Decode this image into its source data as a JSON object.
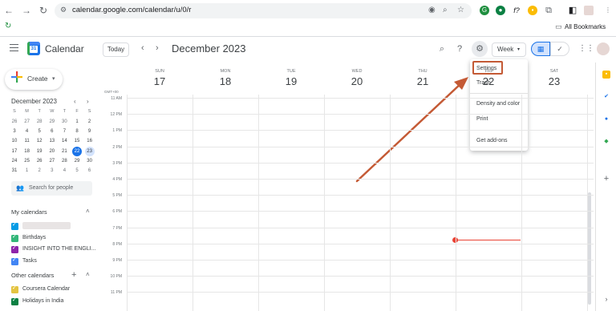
{
  "browser": {
    "url": "calendar.google.com/calendar/u/0/r",
    "bookmarks_label": "All Bookmarks"
  },
  "app": {
    "title": "Calendar",
    "today_label": "Today",
    "month_title": "December 2023",
    "view_select": "Week"
  },
  "create": {
    "label": "Create"
  },
  "mini_calendar": {
    "title": "December 2023",
    "weekday_heads": [
      "S",
      "M",
      "T",
      "W",
      "T",
      "F",
      "S"
    ],
    "weeks": [
      [
        "26",
        "27",
        "28",
        "29",
        "30",
        "1",
        "2"
      ],
      [
        "3",
        "4",
        "5",
        "6",
        "7",
        "8",
        "9"
      ],
      [
        "10",
        "11",
        "12",
        "13",
        "14",
        "15",
        "16"
      ],
      [
        "17",
        "18",
        "19",
        "20",
        "21",
        "22",
        "23"
      ],
      [
        "24",
        "25",
        "26",
        "27",
        "28",
        "29",
        "30"
      ],
      [
        "31",
        "1",
        "2",
        "3",
        "4",
        "5",
        "6"
      ]
    ],
    "selected_day": "22",
    "highlight_day": "23"
  },
  "search_people": {
    "placeholder": "Search for people"
  },
  "my_calendars": {
    "heading": "My calendars",
    "items": [
      {
        "label": "",
        "color": "#039be5"
      },
      {
        "label": "Birthdays",
        "color": "#33b679"
      },
      {
        "label": "INSIGHT INTO THE ENGLI...",
        "color": "#8e24aa"
      },
      {
        "label": "Tasks",
        "color": "#4285f4"
      }
    ]
  },
  "other_calendars": {
    "heading": "Other calendars",
    "items": [
      {
        "label": "Coursera Calendar",
        "color": "#e4c441"
      },
      {
        "label": "Holidays in India",
        "color": "#0b8043"
      }
    ]
  },
  "week": {
    "timezone": "GMT+00",
    "days": [
      {
        "dow": "SUN",
        "num": "17"
      },
      {
        "dow": "MON",
        "num": "18"
      },
      {
        "dow": "TUE",
        "num": "19"
      },
      {
        "dow": "WED",
        "num": "20"
      },
      {
        "dow": "THU",
        "num": "21"
      },
      {
        "dow": "FRI",
        "num": "22"
      },
      {
        "dow": "SAT",
        "num": "23"
      }
    ],
    "hours": [
      "11 AM",
      "12 PM",
      "1 PM",
      "2 PM",
      "3 PM",
      "4 PM",
      "5 PM",
      "6 PM",
      "7 PM",
      "8 PM",
      "9 PM",
      "10 PM",
      "11 PM"
    ]
  },
  "settings_menu": {
    "items": [
      "Settings",
      "Trash",
      "Density and color",
      "Print",
      "Get add-ons"
    ]
  },
  "colors": {
    "accent": "#1a73e8",
    "annotation": "#c45a35",
    "now": "#ea4335"
  }
}
